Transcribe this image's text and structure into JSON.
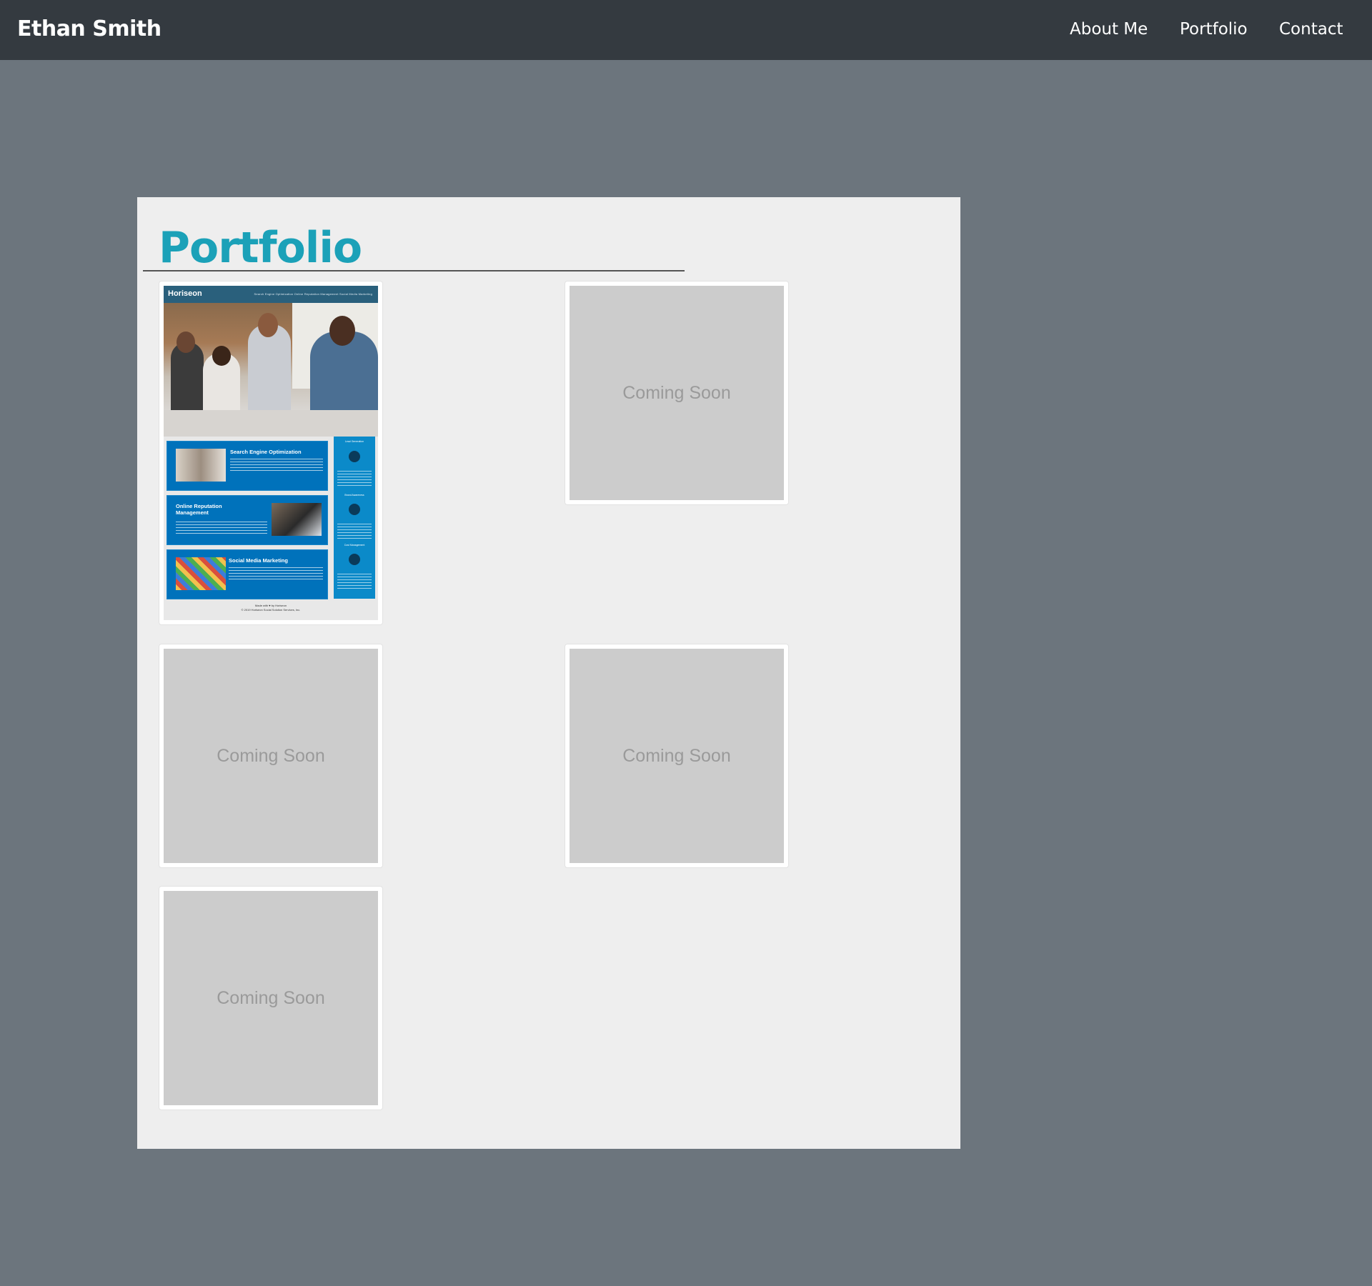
{
  "navbar": {
    "brand": "Ethan Smith",
    "links": [
      {
        "label": "About Me"
      },
      {
        "label": "Portfolio"
      },
      {
        "label": "Contact"
      }
    ]
  },
  "portfolio": {
    "heading": "Portfolio",
    "projects": [
      {
        "name": "Horiseon",
        "mock": {
          "header_brand": "Horiseon",
          "header_nav": "Search Engine Optimization   Online Reputation Management   Social Media Marketing",
          "cards": [
            {
              "title": "Search Engine Optimization"
            },
            {
              "title": "Online Reputation Management"
            },
            {
              "title": "Social Media Marketing"
            }
          ],
          "sidebar": [
            "Lead Generation",
            "Brand Awareness",
            "Cost Management"
          ],
          "footer_line1": "Made with ♥ by Horiseon",
          "footer_line2": "© 2019 Horiseon Social Solution Services, Inc."
        }
      },
      {
        "placeholder": "Coming Soon"
      },
      {
        "placeholder": "Coming Soon"
      },
      {
        "placeholder": "Coming Soon"
      },
      {
        "placeholder": "Coming Soon"
      }
    ]
  },
  "colors": {
    "navbar_bg": "#343a40",
    "page_bg": "#6c757d",
    "panel_bg": "#eeeeee",
    "heading": "#1ba1b8",
    "placeholder_bg": "#cccccc",
    "mock_blue": "#0072bb"
  }
}
